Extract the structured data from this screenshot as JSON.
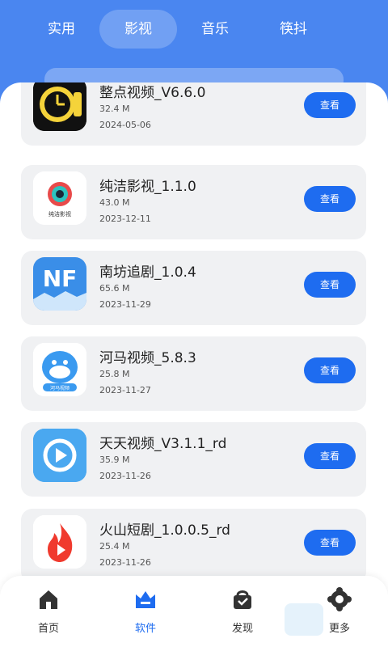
{
  "top_tabs": [
    {
      "label": "实用",
      "active": false
    },
    {
      "label": "影视",
      "active": true
    },
    {
      "label": "音乐",
      "active": false
    },
    {
      "label": "筷抖",
      "active": false
    }
  ],
  "view_button_label": "查看",
  "apps": [
    {
      "name": "整点视频_V6.6.0",
      "size": "32.4 M",
      "date": "2024-05-06",
      "icon": "clock-film-icon",
      "icon_color": "#f5d33a"
    },
    {
      "name": "纯洁影视_1.1.0",
      "size": "43.0 M",
      "date": "2023-12-11",
      "icon": "pure-film-icon",
      "icon_color": "#e84a4a",
      "icon_text": "纯洁影视"
    },
    {
      "name": "南坊追剧_1.0.4",
      "size": "65.6 M",
      "date": "2023-11-29",
      "icon": "nf-logo-icon",
      "icon_color": "#3a8ee8",
      "icon_text": "NF"
    },
    {
      "name": "河马视频_5.8.3",
      "size": "25.8 M",
      "date": "2023-11-27",
      "icon": "hippo-icon",
      "icon_color": "#3a9af0",
      "icon_text": "河马视频"
    },
    {
      "name": "天天视频_V3.1.1_rd",
      "size": "35.9 M",
      "date": "2023-11-26",
      "icon": "play-icon",
      "icon_color": "#4aa8f0"
    },
    {
      "name": "火山短剧_1.0.0.5_rd",
      "size": "25.4 M",
      "date": "2023-11-26",
      "icon": "flame-icon",
      "icon_color": "#f03a2e"
    }
  ],
  "bottom_nav": [
    {
      "label": "首页",
      "icon": "home-icon",
      "active": false
    },
    {
      "label": "软件",
      "icon": "crown-icon",
      "active": true
    },
    {
      "label": "发现",
      "icon": "bag-icon",
      "active": false
    },
    {
      "label": "更多",
      "icon": "gear-icon",
      "active": false
    }
  ],
  "colors": {
    "header": "#4a86f0",
    "accent": "#1e6cf0",
    "card": "#f0f1f3"
  }
}
